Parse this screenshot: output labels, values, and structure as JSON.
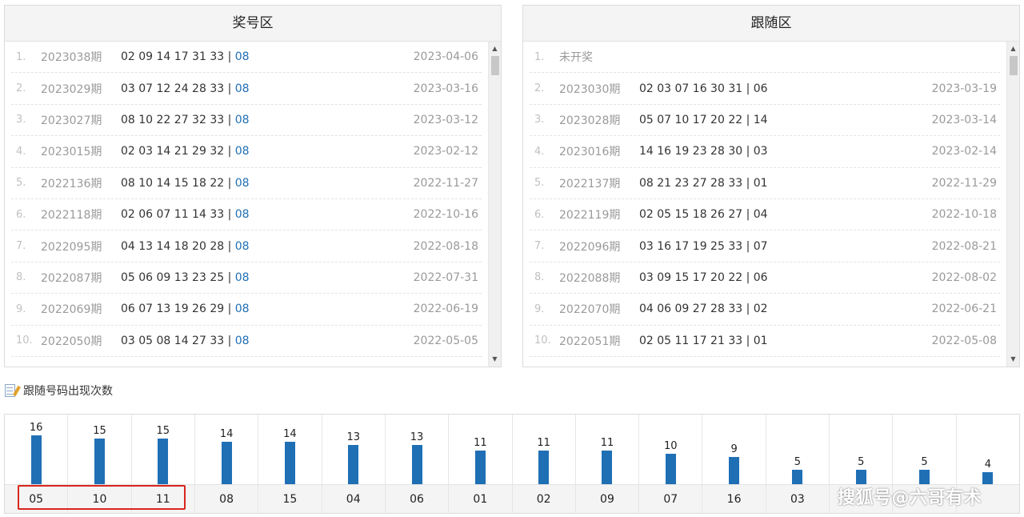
{
  "left_panel": {
    "title": "奖号区",
    "rows": [
      {
        "idx": "1.",
        "issue": "2023038期",
        "nums": "02 09 14 17 31 33 | ",
        "blue": "08",
        "date": "2023-04-06"
      },
      {
        "idx": "2.",
        "issue": "2023029期",
        "nums": "03 07 12 24 28 33 | ",
        "blue": "08",
        "date": "2023-03-16"
      },
      {
        "idx": "3.",
        "issue": "2023027期",
        "nums": "08 10 22 27 32 33 | ",
        "blue": "08",
        "date": "2023-03-12"
      },
      {
        "idx": "4.",
        "issue": "2023015期",
        "nums": "02 03 14 21 29 32 | ",
        "blue": "08",
        "date": "2023-02-12"
      },
      {
        "idx": "5.",
        "issue": "2022136期",
        "nums": "08 10 14 15 18 22 | ",
        "blue": "08",
        "date": "2022-11-27"
      },
      {
        "idx": "6.",
        "issue": "2022118期",
        "nums": "02 06 07 11 14 33 | ",
        "blue": "08",
        "date": "2022-10-16"
      },
      {
        "idx": "7.",
        "issue": "2022095期",
        "nums": "04 13 14 18 20 28 | ",
        "blue": "08",
        "date": "2022-08-18"
      },
      {
        "idx": "8.",
        "issue": "2022087期",
        "nums": "05 06 09 13 23 25 | ",
        "blue": "08",
        "date": "2022-07-31"
      },
      {
        "idx": "9.",
        "issue": "2022069期",
        "nums": "06 07 13 19 26 29 | ",
        "blue": "08",
        "date": "2022-06-19"
      },
      {
        "idx": "10.",
        "issue": "2022050期",
        "nums": "03 05 08 14 27 33 | ",
        "blue": "08",
        "date": "2022-05-05"
      }
    ]
  },
  "right_panel": {
    "title": "跟随区",
    "first_row": {
      "idx": "1.",
      "text": "未开奖"
    },
    "rows": [
      {
        "idx": "2.",
        "issue": "2023030期",
        "nums": "02 03 07 16 30 31 | 06",
        "date": "2023-03-19"
      },
      {
        "idx": "3.",
        "issue": "2023028期",
        "nums": "05 07 10 17 20 22 | 14",
        "date": "2023-03-14"
      },
      {
        "idx": "4.",
        "issue": "2023016期",
        "nums": "14 16 19 23 28 30 | 03",
        "date": "2023-02-14"
      },
      {
        "idx": "5.",
        "issue": "2022137期",
        "nums": "08 21 23 27 28 33 | 01",
        "date": "2022-11-29"
      },
      {
        "idx": "6.",
        "issue": "2022119期",
        "nums": "02 05 15 18 26 27 | 04",
        "date": "2022-10-18"
      },
      {
        "idx": "7.",
        "issue": "2022096期",
        "nums": "03 16 17 19 25 33 | 07",
        "date": "2022-08-21"
      },
      {
        "idx": "8.",
        "issue": "2022088期",
        "nums": "03 09 15 17 20 22 | 06",
        "date": "2022-08-02"
      },
      {
        "idx": "9.",
        "issue": "2022070期",
        "nums": "04 06 09 27 28 33 | 02",
        "date": "2022-06-21"
      },
      {
        "idx": "10.",
        "issue": "2022051期",
        "nums": "02 05 11 17 21 33 | 01",
        "date": "2022-05-08"
      }
    ]
  },
  "section_title": "跟随号码出现次数",
  "section_icon": "edit-document-icon",
  "colors": {
    "bar": "#1f6fb5",
    "blue_number": "#1f6fb5",
    "highlight": "#d9261c"
  },
  "chart_data": {
    "type": "bar",
    "categories": [
      "05",
      "10",
      "11",
      "08",
      "15",
      "04",
      "06",
      "01",
      "02",
      "09",
      "07",
      "16",
      "03",
      "",
      "",
      ""
    ],
    "values": [
      16,
      15,
      15,
      14,
      14,
      13,
      13,
      11,
      11,
      11,
      10,
      9,
      5,
      5,
      5,
      4
    ],
    "ylim": [
      0,
      16
    ],
    "highlighted_categories": [
      "05",
      "10",
      "11"
    ]
  },
  "watermark": "搜狐号@六哥有术"
}
